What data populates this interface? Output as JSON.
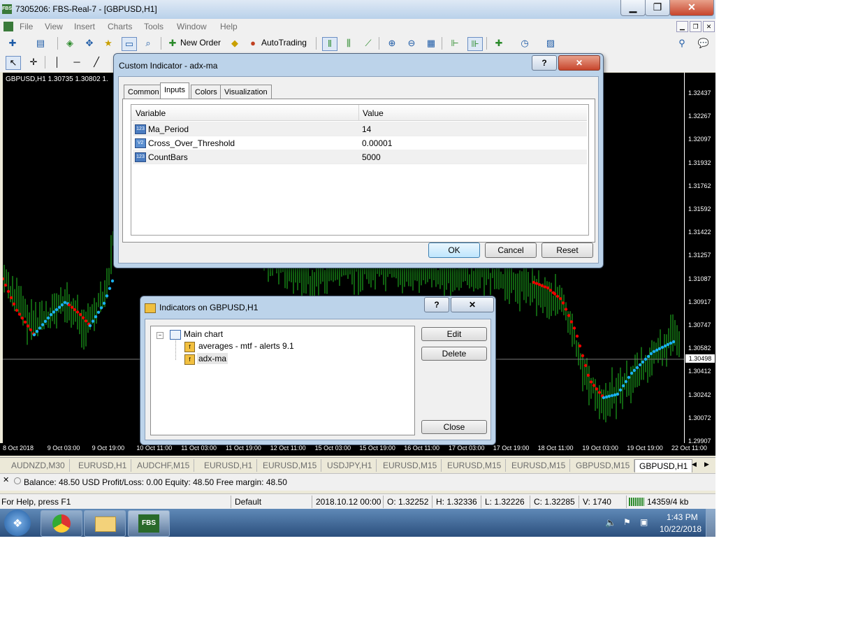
{
  "window": {
    "title": "7305206: FBS-Real-7 - [GBPUSD,H1]",
    "logo": "FBS"
  },
  "menu": [
    "File",
    "View",
    "Insert",
    "Charts",
    "Tools",
    "Window",
    "Help"
  ],
  "toolbar": {
    "new_order": "New Order",
    "auto_trading": "AutoTrading"
  },
  "chart": {
    "info": "GBPUSD,H1  1.30735 1.30802 1.",
    "current_price": "1.30498",
    "price_labels": [
      "1.32437",
      "1.32267",
      "1.32097",
      "1.31932",
      "1.31762",
      "1.31592",
      "1.31422",
      "1.31257",
      "1.31087",
      "1.30917",
      "1.30747",
      "1.30582",
      "1.30412",
      "1.30242",
      "1.30072",
      "1.29907"
    ],
    "time_labels": [
      "8 Oct 2018",
      "9 Oct 03:00",
      "9 Oct 19:00",
      "10 Oct 11:00",
      "11 Oct 03:00",
      "11 Oct 19:00",
      "12 Oct 11:00",
      "15 Oct 03:00",
      "15 Oct 19:00",
      "16 Oct 11:00",
      "17 Oct 03:00",
      "17 Oct 19:00",
      "18 Oct 11:00",
      "19 Oct 03:00",
      "19 Oct 19:00",
      "22 Oct 11:00"
    ]
  },
  "custom_indicator": {
    "title": "Custom Indicator - adx-ma",
    "tabs": [
      "Common",
      "Inputs",
      "Colors",
      "Visualization"
    ],
    "columns": {
      "variable": "Variable",
      "value": "Value"
    },
    "rows": [
      {
        "variable": "Ma_Period",
        "value": "14",
        "type": "123"
      },
      {
        "variable": "Cross_Over_Threshold",
        "value": "0.00001",
        "type": "V2"
      },
      {
        "variable": "CountBars",
        "value": "5000",
        "type": "123"
      }
    ],
    "ok": "OK",
    "cancel": "Cancel",
    "reset": "Reset"
  },
  "indicators_dialog": {
    "title": "Indicators on GBPUSD,H1",
    "root": "Main chart",
    "items": [
      "averages - mtf - alerts  9.1",
      "adx-ma"
    ],
    "edit": "Edit",
    "delete": "Delete",
    "close": "Close"
  },
  "chart_tabs": [
    "AUDNZD,M30",
    "EURUSD,H1",
    "AUDCHF,M15",
    "EURUSD,H1",
    "EURUSD,M15",
    "USDJPY,H1",
    "EURUSD,M15",
    "EURUSD,M15",
    "EURUSD,M15",
    "GBPUSD,M15",
    "GBPUSD,H1"
  ],
  "balance": "Balance: 48.50 USD  Profit/Loss: 0.00  Equity: 48.50  Free margin: 48.50",
  "status": {
    "help": "For Help, press F1",
    "profile": "Default",
    "datetime": "2018.10.12 00:00",
    "open": "O: 1.32252",
    "high": "H: 1.32336",
    "low": "L: 1.32226",
    "close": "C: 1.32285",
    "volume": "V: 1740",
    "traffic": "14359/4 kb"
  },
  "taskbar": {
    "time": "1:43 PM",
    "date": "10/22/2018",
    "fbs": "FBS"
  }
}
